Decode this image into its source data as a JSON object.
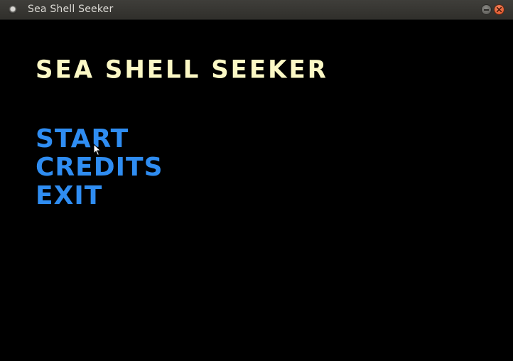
{
  "window": {
    "title": "Sea Shell Seeker"
  },
  "game": {
    "title": "SEA SHELL SEEKER",
    "menu": [
      {
        "label": "START"
      },
      {
        "label": "CREDITS"
      },
      {
        "label": "EXIT"
      }
    ]
  },
  "colors": {
    "title_color": "#fbf8c5",
    "menu_color": "#2f8df2",
    "background": "#000000"
  },
  "icons": {
    "app": "app-icon",
    "minimize": "minimize-icon",
    "close": "close-icon",
    "cursor": "mouse-pointer-icon"
  }
}
